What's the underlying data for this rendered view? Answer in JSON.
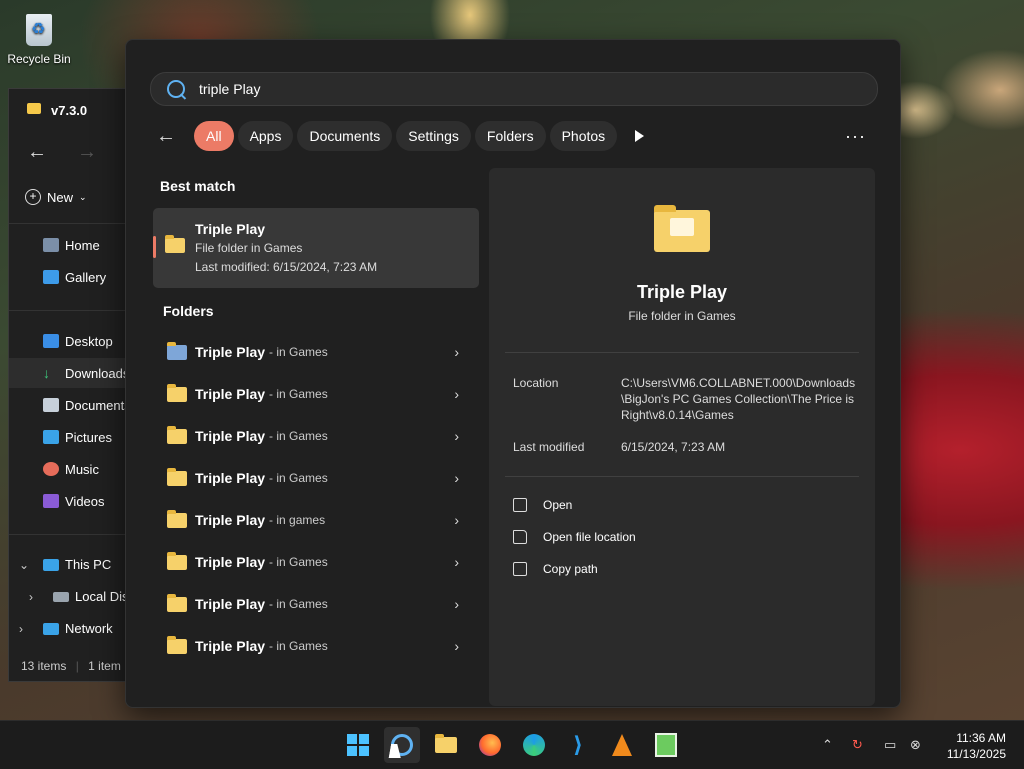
{
  "desktop": {
    "recycle_bin": "Recycle Bin"
  },
  "explorer": {
    "title": "v7.3.0",
    "new_label": "New",
    "nav": [
      "Home",
      "Gallery",
      "Desktop",
      "Downloads",
      "Documents",
      "Pictures",
      "Music",
      "Videos"
    ],
    "tree": [
      "This PC",
      "Local Disk",
      "Network"
    ],
    "status_items": "13 items",
    "status_selected": "1 item"
  },
  "search": {
    "query": "triple Play",
    "filters": [
      "All",
      "Apps",
      "Documents",
      "Settings",
      "Folders",
      "Photos"
    ],
    "best_match_heading": "Best match",
    "best_match": {
      "name": "Triple Play",
      "subtitle": "File folder in Games",
      "modified": "Last modified: 6/15/2024, 7:23 AM"
    },
    "folders_heading": "Folders",
    "folders": [
      {
        "name": "Triple Play",
        "loc": "- in Games"
      },
      {
        "name": "Triple Play",
        "loc": "- in Games"
      },
      {
        "name": "Triple Play",
        "loc": "- in Games"
      },
      {
        "name": "Triple Play",
        "loc": "- in Games"
      },
      {
        "name": "Triple Play",
        "loc": "- in games"
      },
      {
        "name": "Triple Play",
        "loc": "- in Games"
      },
      {
        "name": "Triple Play",
        "loc": "- in Games"
      },
      {
        "name": "Triple Play",
        "loc": "- in Games"
      }
    ],
    "preview": {
      "name": "Triple Play",
      "subtitle": "File folder in Games",
      "location_label": "Location",
      "location_value": "C:\\Users\\VM6.COLLABNET.000\\Downloads\\BigJon's PC Games Collection\\The Price is Right\\v8.0.14\\Games",
      "modified_label": "Last modified",
      "modified_value": "6/15/2024, 7:23 AM",
      "actions": [
        "Open",
        "Open file location",
        "Copy path"
      ]
    }
  },
  "taskbar": {
    "time": "11:36 AM",
    "date": "11/13/2025"
  },
  "colors": {
    "accent": "#ec7b66",
    "panel": "#202020",
    "folder": "#f6d16a"
  }
}
